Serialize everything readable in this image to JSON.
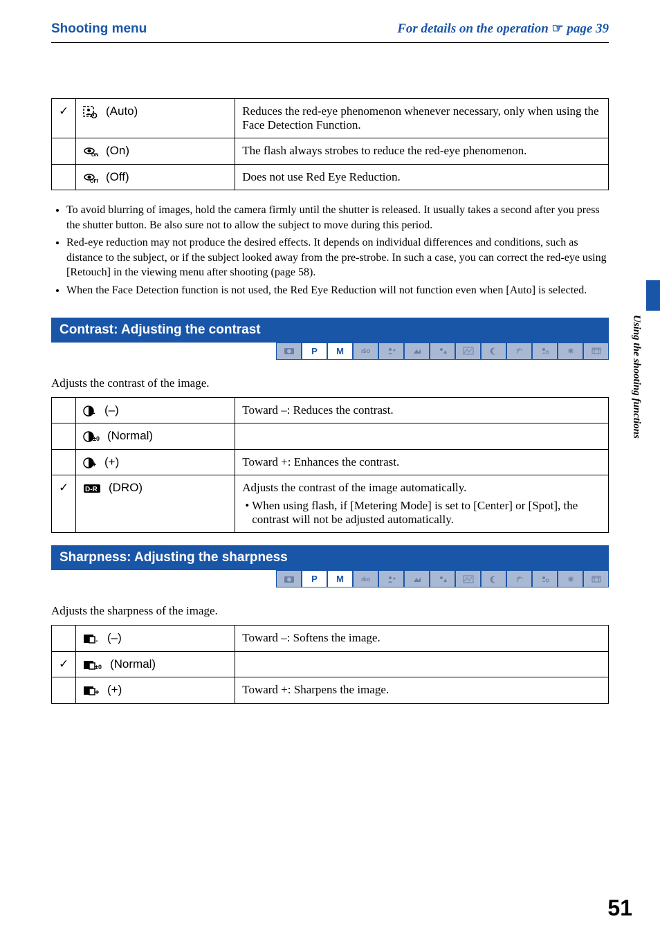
{
  "header": {
    "left": "Shooting menu",
    "right_prefix": "For details on the operation ",
    "right_page_ref": "page 39"
  },
  "redeye_table": {
    "rows": [
      {
        "check": "✓",
        "icon": "face-auto",
        "label": "(Auto)",
        "desc": "Reduces the red-eye phenomenon whenever necessary, only when using the Face Detection Function."
      },
      {
        "check": "",
        "icon": "eye-on",
        "label": "(On)",
        "desc": "The flash always strobes to reduce the red-eye phenomenon."
      },
      {
        "check": "",
        "icon": "eye-off",
        "label": "(Off)",
        "desc": "Does not use Red Eye Reduction."
      }
    ]
  },
  "redeye_bullets": [
    "To avoid blurring of images, hold the camera firmly until the shutter is released. It usually takes a second after you press the shutter button. Be also sure not to allow the subject to move during this period.",
    "Red-eye reduction may not produce the desired effects. It depends on individual differences and conditions, such as distance to the subject, or if the subject looked away from the pre-strobe. In such a case, you can correct the red-eye using [Retouch] in the viewing menu after shooting (page 58).",
    "When the Face Detection function is not used, the Red Eye Reduction will not function even when [Auto] is selected."
  ],
  "contrast": {
    "title": "Contrast: Adjusting the contrast",
    "intro": "Adjusts the contrast of the image.",
    "rows": [
      {
        "check": "",
        "icon": "contrast-minus",
        "label": "(–)",
        "desc": "Toward –: Reduces the contrast."
      },
      {
        "check": "",
        "icon": "contrast-normal",
        "label": "(Normal)",
        "desc": ""
      },
      {
        "check": "",
        "icon": "contrast-plus",
        "label": "(+)",
        "desc": "Toward +: Enhances the contrast."
      },
      {
        "check": "✓",
        "icon": "dro",
        "label": "(DRO)",
        "desc": "Adjusts the contrast of the image automatically.",
        "sub": "When using flash, if [Metering Mode] is set to [Center] or [Spot], the contrast will not be adjusted automatically."
      }
    ]
  },
  "sharpness": {
    "title": "Sharpness: Adjusting the sharpness",
    "intro": "Adjusts the sharpness of the image.",
    "rows": [
      {
        "check": "",
        "icon": "sharp-minus",
        "label": "(–)",
        "desc": "Toward –: Softens the image."
      },
      {
        "check": "✓",
        "icon": "sharp-normal",
        "label": "(Normal)",
        "desc": ""
      },
      {
        "check": "",
        "icon": "sharp-plus",
        "label": "(+)",
        "desc": "Toward +: Sharpens the image."
      }
    ]
  },
  "mode_labels": [
    "●",
    "P",
    "M",
    "ISO",
    "⚙",
    "▧",
    "⛰",
    "▲",
    "☽",
    "⛱",
    "8",
    "✺",
    "⊞"
  ],
  "side_text": "Using the shooting functions",
  "page_number": "51"
}
